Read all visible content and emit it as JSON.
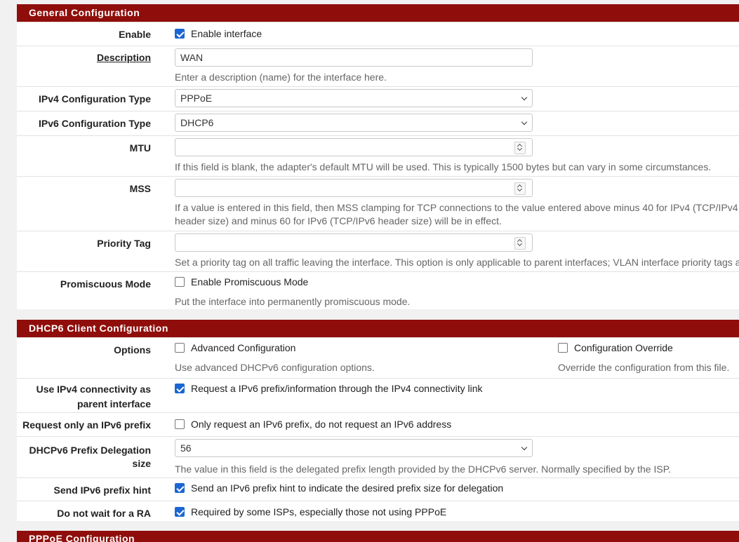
{
  "general": {
    "header": "General Configuration",
    "enable": {
      "label": "Enable",
      "checkbox_label": "Enable interface",
      "checked": true
    },
    "description": {
      "label": "Description",
      "value": "WAN",
      "help": "Enter a description (name) for the interface here."
    },
    "ipv4_type": {
      "label": "IPv4 Configuration Type",
      "value": "PPPoE"
    },
    "ipv6_type": {
      "label": "IPv6 Configuration Type",
      "value": "DHCP6"
    },
    "mtu": {
      "label": "MTU",
      "value": "",
      "help": "If this field is blank, the adapter's default MTU will be used. This is typically 1500 bytes but can vary in some circumstances."
    },
    "mss": {
      "label": "MSS",
      "value": "",
      "help": "If a value is entered in this field, then MSS clamping for TCP connections to the value entered above minus 40 for IPv4 (TCP/IPv4 header size) and minus 60 for IPv6 (TCP/IPv6 header size) will be in effect."
    },
    "priority_tag": {
      "label": "Priority Tag",
      "value": "",
      "help": "Set a priority tag on all traffic leaving the interface. This option is only applicable to parent interfaces; VLAN interface priority tags are s"
    },
    "promiscuous": {
      "label": "Promiscuous Mode",
      "checkbox_label": "Enable Promiscuous Mode",
      "checked": false,
      "help": "Put the interface into permanently promiscuous mode."
    }
  },
  "dhcp6": {
    "header": "DHCP6 Client Configuration",
    "options": {
      "label": "Options",
      "advanced": {
        "checkbox_label": "Advanced Configuration",
        "checked": false,
        "help": "Use advanced DHCPv6 configuration options."
      },
      "override": {
        "checkbox_label": "Configuration Override",
        "checked": false,
        "help": "Override the configuration from this file."
      }
    },
    "use_ipv4": {
      "label_line1": "Use IPv4 connectivity as",
      "label_line2": "parent interface",
      "checkbox_label": "Request a IPv6 prefix/information through the IPv4 connectivity link",
      "checked": true
    },
    "request_prefix_only": {
      "label": "Request only an IPv6 prefix",
      "checkbox_label": "Only request an IPv6 prefix, do not request an IPv6 address",
      "checked": false
    },
    "prefix_delegation": {
      "label_line1": "DHCPv6 Prefix Delegation",
      "label_line2": "size",
      "value": "56",
      "help": "The value in this field is the delegated prefix length provided by the DHCPv6 server. Normally specified by the ISP."
    },
    "prefix_hint": {
      "label": "Send IPv6 prefix hint",
      "checkbox_label": "Send an IPv6 prefix hint to indicate the desired prefix size for delegation",
      "checked": true
    },
    "no_wait_ra": {
      "label": "Do not wait for a RA",
      "checkbox_label": "Required by some ISPs, especially those not using PPPoE",
      "checked": true
    }
  },
  "pppoe": {
    "header": "PPPoE Configuration"
  }
}
